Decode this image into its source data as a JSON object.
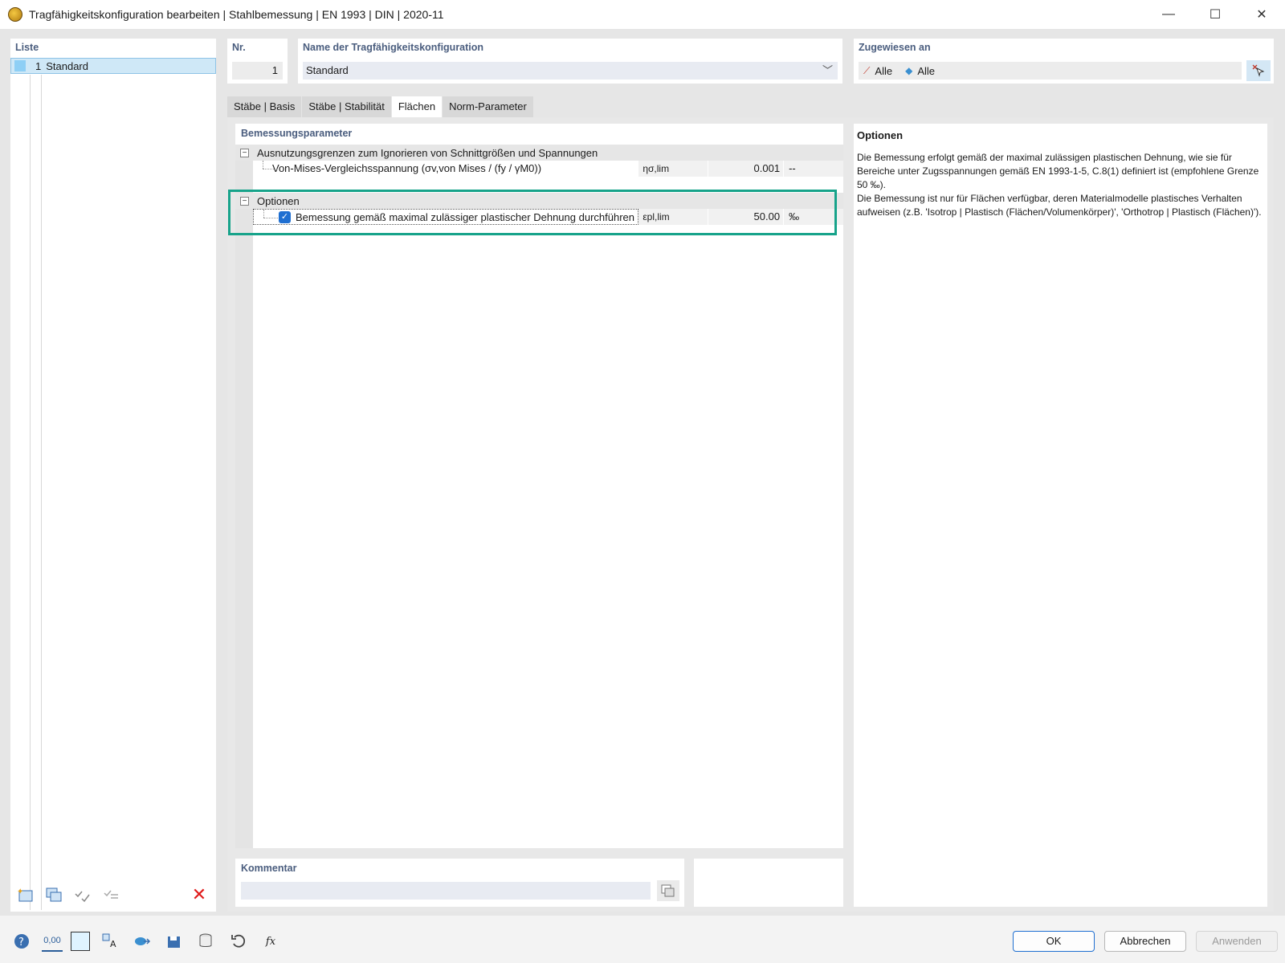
{
  "window": {
    "title": "Tragfähigkeitskonfiguration bearbeiten | Stahlbemessung | EN 1993 | DIN | 2020-11",
    "minimize": "—",
    "maximize": "☐",
    "close": "✕"
  },
  "list": {
    "title": "Liste",
    "items": [
      {
        "num": "1",
        "name": "Standard"
      }
    ]
  },
  "nr": {
    "label": "Nr.",
    "value": "1"
  },
  "name": {
    "label": "Name der Tragfähigkeitskonfiguration",
    "value": "Standard"
  },
  "assigned": {
    "label": "Zugewiesen an",
    "members": "Alle",
    "surfaces": "Alle"
  },
  "tabs": [
    {
      "label": "Stäbe | Basis"
    },
    {
      "label": "Stäbe | Stabilität"
    },
    {
      "label": "Flächen"
    },
    {
      "label": "Norm-Parameter"
    }
  ],
  "params": {
    "title": "Bemessungsparameter",
    "groups": [
      {
        "label": "Ausnutzungsgrenzen zum Ignorieren von Schnittgrößen und Spannungen",
        "rows": [
          {
            "label": "Von-Mises-Vergleichsspannung (σv,von Mises / (fy / γM0))",
            "symbol": "ησ,lim",
            "value": "0.001",
            "unit": "--"
          }
        ]
      },
      {
        "label": "Optionen",
        "rows": [
          {
            "label": "Bemessung gemäß maximal zulässiger plastischer Dehnung durchführen",
            "symbol": "εpl,lim",
            "value": "50.00",
            "unit": "‰",
            "checked": true
          }
        ]
      }
    ]
  },
  "help": {
    "title": "Optionen",
    "text1": "Die Bemessung erfolgt gemäß der maximal zulässigen plastischen Dehnung, wie sie für Bereiche unter Zugsspannungen gemäß EN 1993-1-5, C.8(1) definiert ist (empfohlene Grenze 50 ‰).",
    "text2": "Die Bemessung ist nur für Flächen verfügbar, deren Materialmodelle plastisches Verhalten aufweisen (z.B. 'Isotrop | Plastisch (Flächen/Volumenkörper)', 'Orthotrop | Plastisch (Flächen)')."
  },
  "comment": {
    "label": "Kommentar",
    "value": ""
  },
  "buttons": {
    "ok": "OK",
    "cancel": "Abbrechen",
    "apply": "Anwenden"
  },
  "bottom_tools": {
    "units_label": "0,00"
  },
  "colors": {
    "accent": "#1f6fd1",
    "highlight": "#17a38a",
    "panel_title": "#4a5d7e"
  }
}
